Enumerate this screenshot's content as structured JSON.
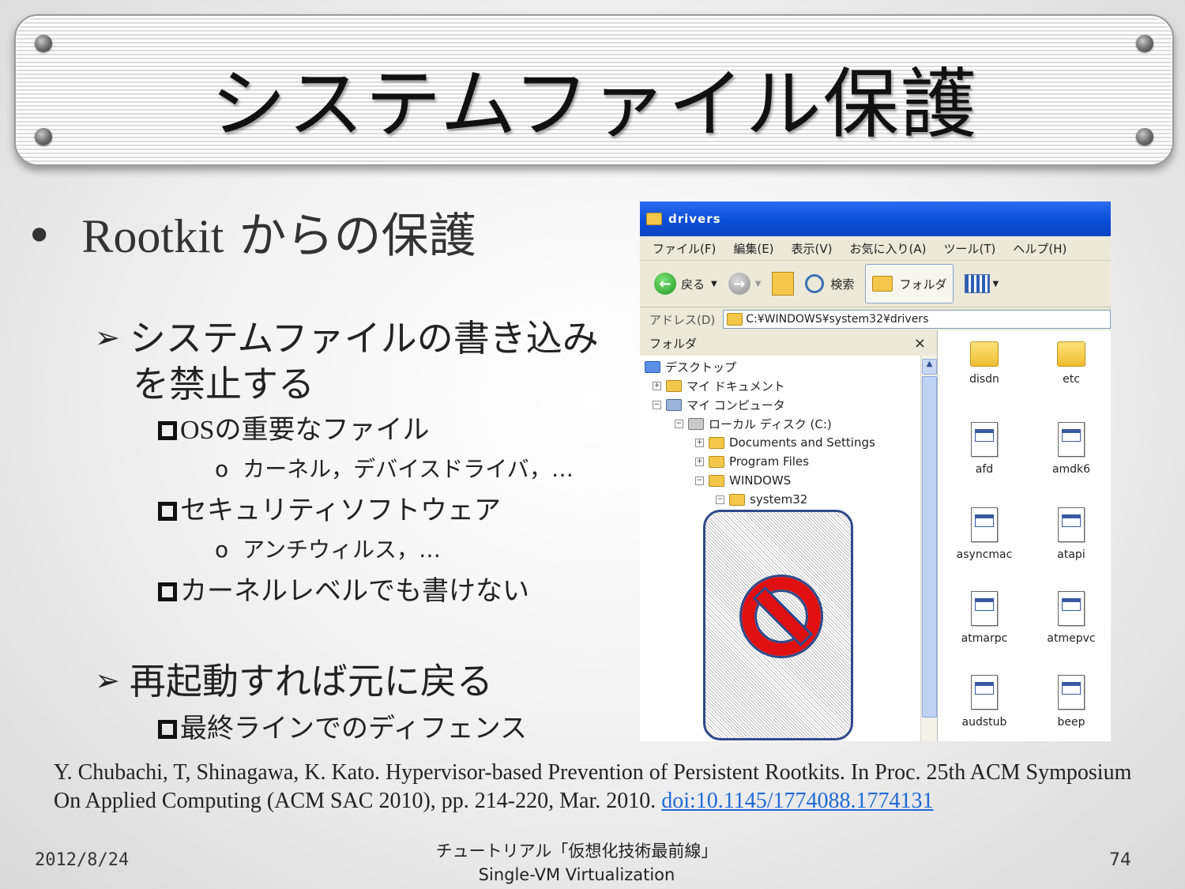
{
  "title": "システムファイル保護",
  "bullets": {
    "level1": {
      "rootkit": "Rootkit",
      "rest": " からの保護"
    },
    "sub1": {
      "line1": "システムファイルの書き込み",
      "line2": "を禁止する"
    },
    "os_files": {
      "os": "OS",
      "rest": "の重要なファイル"
    },
    "kernel_examples": "カーネル，デバイスドライバ，…",
    "security_software": "セキュリティソフトウェア",
    "antivirus": "アンチウィルス，…",
    "kernel_level": "カーネルレベルでも書けない",
    "sub2": "再起動すれば元に戻る",
    "final_defense": "最終ラインでのディフェンス",
    "arrow_glyph": "➢",
    "circle_glyph": "o"
  },
  "explorer": {
    "window_title": "drivers",
    "menu": [
      "ファイル(F)",
      "編集(E)",
      "表示(V)",
      "お気に入り(A)",
      "ツール(T)",
      "ヘルプ(H)"
    ],
    "toolbar": {
      "back": "戻る",
      "search": "検索",
      "folders": "フォルダ"
    },
    "address_label": "アドレス(D)",
    "address_value": "C:¥WINDOWS¥system32¥drivers",
    "tree_header": "フォルダ",
    "tree_close": "×",
    "tree": [
      "デスクトップ",
      "マイ ドキュメント",
      "マイ コンピュータ",
      "ローカル ディスク (C:)",
      "Documents and Settings",
      "Program Files",
      "WINDOWS",
      "system32"
    ],
    "files": [
      {
        "name": "disdn",
        "kind": "folder"
      },
      {
        "name": "etc",
        "kind": "folder"
      },
      {
        "name": "afd",
        "kind": "sys"
      },
      {
        "name": "amdk6",
        "kind": "sys"
      },
      {
        "name": "asyncmac",
        "kind": "sys"
      },
      {
        "name": "atapi",
        "kind": "sys"
      },
      {
        "name": "atmarpc",
        "kind": "sys"
      },
      {
        "name": "atmepvc",
        "kind": "sys"
      },
      {
        "name": "audstub",
        "kind": "sys"
      },
      {
        "name": "beep",
        "kind": "sys"
      }
    ]
  },
  "citation": {
    "text": "Y. Chubachi, T, Shinagawa, K. Kato. Hypervisor-based Prevention of Persistent Rootkits. In Proc. 25th ACM Symposium On Applied Computing (ACM SAC 2010), pp. 214-220, Mar. 2010. ",
    "doi": "doi:10.1145/1774088.1774131"
  },
  "footer": {
    "date": "2012/8/24",
    "center_line1": "チュートリアル「仮想化技術最前線」",
    "center_line2": "Single-VM Virtualization",
    "page": "74"
  },
  "colors": {
    "xp_title_blue": "#0a4ed8",
    "prohibit_red": "#e01010",
    "link_blue": "#1e6ad6"
  }
}
